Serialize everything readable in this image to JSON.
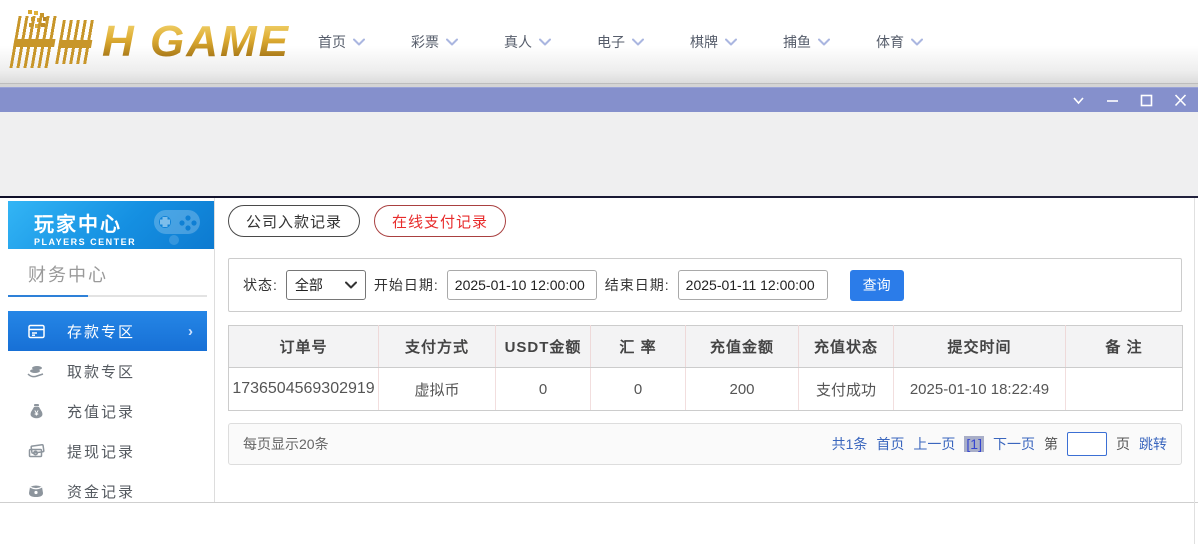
{
  "logo": {
    "text": "H GAME"
  },
  "navbar": {
    "items": [
      {
        "label": "首页"
      },
      {
        "label": "彩票"
      },
      {
        "label": "真人"
      },
      {
        "label": "电子"
      },
      {
        "label": "棋牌"
      },
      {
        "label": "捕鱼"
      },
      {
        "label": "体育"
      }
    ]
  },
  "titlebar": {
    "controls": [
      "chevron-down",
      "minimize",
      "maximize",
      "close"
    ]
  },
  "sidebar": {
    "header": {
      "title": "玩家中心",
      "subtitle": "PLAYERS CENTER"
    },
    "section_title": "财务中心",
    "items": [
      {
        "label": "存款专区",
        "icon": "deposit-card-icon",
        "active": true
      },
      {
        "label": "取款专区",
        "icon": "withdraw-hand-icon",
        "active": false
      },
      {
        "label": "充值记录",
        "icon": "moneybag-icon",
        "active": false
      },
      {
        "label": "提现记录",
        "icon": "banknotes-icon",
        "active": false
      },
      {
        "label": "资金记录",
        "icon": "purse-icon",
        "active": false
      }
    ]
  },
  "main": {
    "tabs": [
      {
        "label": "公司入款记录",
        "active": false
      },
      {
        "label": "在线支付记录",
        "active": true
      }
    ],
    "filters": {
      "status_label": "状态:",
      "status_value": "全部",
      "start_label": "开始日期:",
      "start_value": "2025-01-10 12:00:00",
      "end_label": "结束日期:",
      "end_value": "2025-01-11 12:00:00",
      "search_label": "查询"
    },
    "table": {
      "headers": [
        "订单号",
        "支付方式",
        "USDT金额",
        "汇 率",
        "充值金额",
        "充值状态",
        "提交时间",
        "备 注"
      ],
      "rows": [
        [
          "1736504569302919",
          "虚拟币",
          "0",
          "0",
          "200",
          "支付成功",
          "2025-01-10 18:22:49",
          ""
        ]
      ]
    },
    "pagination": {
      "per_page": "每页显示20条",
      "total": "共1条",
      "first": "首页",
      "prev": "上一页",
      "current": "[1]",
      "next": "下一页",
      "jump_label_pre": "第",
      "jump_label_post": "页",
      "jump": "跳转",
      "page_input_value": ""
    }
  },
  "colors": {
    "titlebar": "#8590cc",
    "sidebar_active": "#1b79dd",
    "accent_blue": "#2b7ce9",
    "link_blue": "#3a66be",
    "tab_red": "#e82c2c",
    "logo_gold": "#d9a62e"
  }
}
